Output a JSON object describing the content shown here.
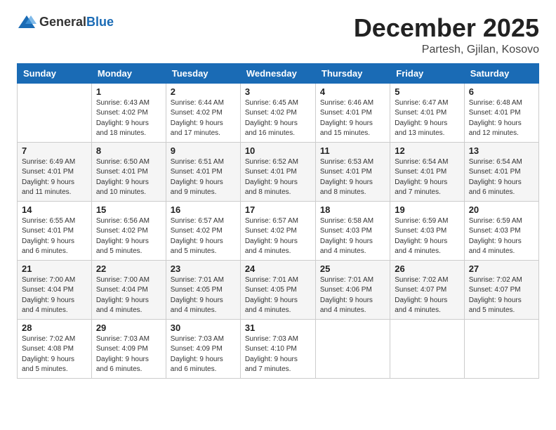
{
  "logo": {
    "general": "General",
    "blue": "Blue"
  },
  "header": {
    "month": "December 2025",
    "location": "Partesh, Gjilan, Kosovo"
  },
  "weekdays": [
    "Sunday",
    "Monday",
    "Tuesday",
    "Wednesday",
    "Thursday",
    "Friday",
    "Saturday"
  ],
  "weeks": [
    [
      {
        "day": "",
        "info": ""
      },
      {
        "day": "1",
        "info": "Sunrise: 6:43 AM\nSunset: 4:02 PM\nDaylight: 9 hours\nand 18 minutes."
      },
      {
        "day": "2",
        "info": "Sunrise: 6:44 AM\nSunset: 4:02 PM\nDaylight: 9 hours\nand 17 minutes."
      },
      {
        "day": "3",
        "info": "Sunrise: 6:45 AM\nSunset: 4:02 PM\nDaylight: 9 hours\nand 16 minutes."
      },
      {
        "day": "4",
        "info": "Sunrise: 6:46 AM\nSunset: 4:01 PM\nDaylight: 9 hours\nand 15 minutes."
      },
      {
        "day": "5",
        "info": "Sunrise: 6:47 AM\nSunset: 4:01 PM\nDaylight: 9 hours\nand 13 minutes."
      },
      {
        "day": "6",
        "info": "Sunrise: 6:48 AM\nSunset: 4:01 PM\nDaylight: 9 hours\nand 12 minutes."
      }
    ],
    [
      {
        "day": "7",
        "info": "Sunrise: 6:49 AM\nSunset: 4:01 PM\nDaylight: 9 hours\nand 11 minutes."
      },
      {
        "day": "8",
        "info": "Sunrise: 6:50 AM\nSunset: 4:01 PM\nDaylight: 9 hours\nand 10 minutes."
      },
      {
        "day": "9",
        "info": "Sunrise: 6:51 AM\nSunset: 4:01 PM\nDaylight: 9 hours\nand 9 minutes."
      },
      {
        "day": "10",
        "info": "Sunrise: 6:52 AM\nSunset: 4:01 PM\nDaylight: 9 hours\nand 8 minutes."
      },
      {
        "day": "11",
        "info": "Sunrise: 6:53 AM\nSunset: 4:01 PM\nDaylight: 9 hours\nand 8 minutes."
      },
      {
        "day": "12",
        "info": "Sunrise: 6:54 AM\nSunset: 4:01 PM\nDaylight: 9 hours\nand 7 minutes."
      },
      {
        "day": "13",
        "info": "Sunrise: 6:54 AM\nSunset: 4:01 PM\nDaylight: 9 hours\nand 6 minutes."
      }
    ],
    [
      {
        "day": "14",
        "info": "Sunrise: 6:55 AM\nSunset: 4:01 PM\nDaylight: 9 hours\nand 6 minutes."
      },
      {
        "day": "15",
        "info": "Sunrise: 6:56 AM\nSunset: 4:02 PM\nDaylight: 9 hours\nand 5 minutes."
      },
      {
        "day": "16",
        "info": "Sunrise: 6:57 AM\nSunset: 4:02 PM\nDaylight: 9 hours\nand 5 minutes."
      },
      {
        "day": "17",
        "info": "Sunrise: 6:57 AM\nSunset: 4:02 PM\nDaylight: 9 hours\nand 4 minutes."
      },
      {
        "day": "18",
        "info": "Sunrise: 6:58 AM\nSunset: 4:03 PM\nDaylight: 9 hours\nand 4 minutes."
      },
      {
        "day": "19",
        "info": "Sunrise: 6:59 AM\nSunset: 4:03 PM\nDaylight: 9 hours\nand 4 minutes."
      },
      {
        "day": "20",
        "info": "Sunrise: 6:59 AM\nSunset: 4:03 PM\nDaylight: 9 hours\nand 4 minutes."
      }
    ],
    [
      {
        "day": "21",
        "info": "Sunrise: 7:00 AM\nSunset: 4:04 PM\nDaylight: 9 hours\nand 4 minutes."
      },
      {
        "day": "22",
        "info": "Sunrise: 7:00 AM\nSunset: 4:04 PM\nDaylight: 9 hours\nand 4 minutes."
      },
      {
        "day": "23",
        "info": "Sunrise: 7:01 AM\nSunset: 4:05 PM\nDaylight: 9 hours\nand 4 minutes."
      },
      {
        "day": "24",
        "info": "Sunrise: 7:01 AM\nSunset: 4:05 PM\nDaylight: 9 hours\nand 4 minutes."
      },
      {
        "day": "25",
        "info": "Sunrise: 7:01 AM\nSunset: 4:06 PM\nDaylight: 9 hours\nand 4 minutes."
      },
      {
        "day": "26",
        "info": "Sunrise: 7:02 AM\nSunset: 4:07 PM\nDaylight: 9 hours\nand 4 minutes."
      },
      {
        "day": "27",
        "info": "Sunrise: 7:02 AM\nSunset: 4:07 PM\nDaylight: 9 hours\nand 5 minutes."
      }
    ],
    [
      {
        "day": "28",
        "info": "Sunrise: 7:02 AM\nSunset: 4:08 PM\nDaylight: 9 hours\nand 5 minutes."
      },
      {
        "day": "29",
        "info": "Sunrise: 7:03 AM\nSunset: 4:09 PM\nDaylight: 9 hours\nand 6 minutes."
      },
      {
        "day": "30",
        "info": "Sunrise: 7:03 AM\nSunset: 4:09 PM\nDaylight: 9 hours\nand 6 minutes."
      },
      {
        "day": "31",
        "info": "Sunrise: 7:03 AM\nSunset: 4:10 PM\nDaylight: 9 hours\nand 7 minutes."
      },
      {
        "day": "",
        "info": ""
      },
      {
        "day": "",
        "info": ""
      },
      {
        "day": "",
        "info": ""
      }
    ]
  ]
}
